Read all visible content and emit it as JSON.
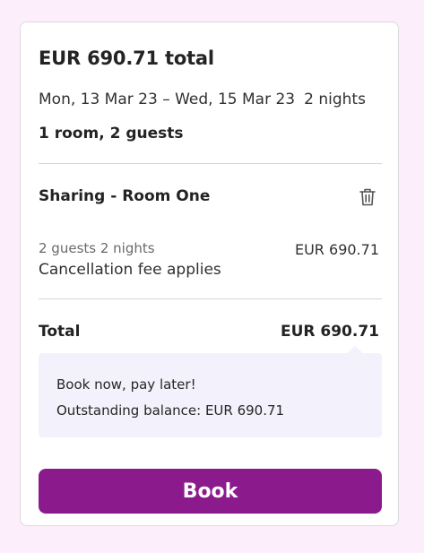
{
  "summary": {
    "title": "EUR 690.71 total",
    "dates": "Mon, 13 Mar 23 – Wed, 15 Mar 23",
    "nights": "2 nights",
    "occupancy": "1 room, 2 guests"
  },
  "room": {
    "name": "Sharing - Room One",
    "meta": "2 guests 2 nights",
    "cancellation": "Cancellation fee applies",
    "price": "EUR 690.71",
    "delete_icon": "trash-icon"
  },
  "total": {
    "label": "Total",
    "value": "EUR 690.71"
  },
  "notice": {
    "line1": "Book now, pay later!",
    "line2": "Outstanding balance: EUR 690.71"
  },
  "actions": {
    "book_label": "Book"
  },
  "colors": {
    "page_background": "#fdeefc",
    "primary_button": "#8b1a8d",
    "notice_background": "#f3f2fc"
  }
}
